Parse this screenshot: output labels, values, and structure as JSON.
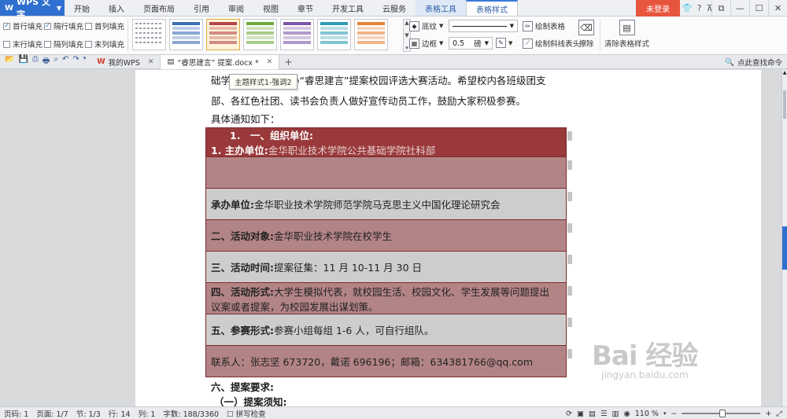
{
  "app": {
    "name": "WPS 文字",
    "logo": "W"
  },
  "menu": {
    "items": [
      "开始",
      "插入",
      "页面布局",
      "引用",
      "审阅",
      "视图",
      "章节",
      "开发工具",
      "云服务",
      "表格工具",
      "表格样式"
    ],
    "context_tab": "表格工具",
    "active_tab": "表格样式",
    "login": "未登录"
  },
  "top_icons": [
    "shirt-icon",
    "help-icon",
    "collapse-icon"
  ],
  "top_icon_glyphs": {
    "shirt": "👕",
    "help": "?",
    "collapse": "⊼"
  },
  "ribbon": {
    "checks": [
      {
        "label": "首行填充",
        "checked": true
      },
      {
        "label": "隔行填充",
        "checked": true
      },
      {
        "label": "首列填充",
        "checked": false
      },
      {
        "label": "末行填充",
        "checked": false
      },
      {
        "label": "隔列填充",
        "checked": false
      },
      {
        "label": "末列填充",
        "checked": false
      }
    ],
    "styles": [
      {
        "name": "plain",
        "color": "#9aa0a8"
      },
      {
        "name": "blue",
        "color": "#3c6db4"
      },
      {
        "name": "red",
        "color": "#b4444a"
      },
      {
        "name": "green",
        "color": "#6fa83b"
      },
      {
        "name": "purple",
        "color": "#7c56a8"
      },
      {
        "name": "teal",
        "color": "#2f9db4"
      },
      {
        "name": "orange",
        "color": "#e4823a"
      }
    ],
    "shading_label": "底纹",
    "border_label": "边框",
    "line_width": "0.5",
    "line_unit": "磅",
    "draw_table": "绘制表格",
    "draw_diag": "绘制斜线表头",
    "erase": "擦除",
    "clear_style": "清除表格样式"
  },
  "tabs": {
    "items": [
      {
        "label": "我的WPS",
        "icon": "W"
      },
      {
        "label": "“睿思建言” 提案.docx *",
        "icon": "doc"
      }
    ],
    "add": "+",
    "search_cmd": "点此查找命令"
  },
  "tooltip": "主题样式1-强调2",
  "document": {
    "lines": [
      "础学院社科部拟举办“睿思建言”提案校园评选大赛活动。希望校内各班级团支",
      "部、各红色社团、读书会负责人做好宣传动员工作，鼓励大家积极参赛。",
      "具体通知如下："
    ],
    "table": [
      {
        "style": "dark",
        "bold": "1.　一、组织单位:",
        "text": "",
        "sub_bold": "1. 主办单位:",
        "sub_text": "金华职业技术学院公共基础学院社科部"
      },
      {
        "style": "mid",
        "bold": "",
        "text": ""
      },
      {
        "style": "light",
        "bold": "承办单位:",
        "text": "金华职业技术学院师范学院马克思主义中国化理论研究会"
      },
      {
        "style": "mid",
        "bold": "二、活动对象:",
        "text": "金华职业技术学院在校学生"
      },
      {
        "style": "light",
        "bold": "三、活动时间:",
        "text": "提案征集：11 月 10-11 月 30 日"
      },
      {
        "style": "mid",
        "bold": "四、活动形式:",
        "text": "大学生模拟代表，就校园生活、校园文化、学生发展等问题提出",
        "text2": "议案或者提案，为校园发展出谋划策。"
      },
      {
        "style": "light",
        "bold": "五、参赛形式:",
        "text": "参赛小组每组 1-6 人，可自行组队。"
      },
      {
        "style": "mid",
        "bold": "",
        "text": "联系人：张志坚 673720，戴诺 696196；邮箱：634381766@qq.com"
      }
    ],
    "after": [
      "六、提案要求:",
      "（一）提案须知:"
    ]
  },
  "watermark": {
    "brand": "Bai 经验",
    "url": "jingyan.baidu.com"
  },
  "status": {
    "page_num": "页码: 1",
    "pages": "页面: 1/7",
    "section": "节: 1/3",
    "row": "行: 14",
    "col": "列: 1",
    "words": "字数: 188/3360",
    "spell": "拼写检查",
    "zoom": "110 %"
  },
  "colors": {
    "accent": "#2f6fcf",
    "login": "#e8553e",
    "table_dark": "#99393b",
    "table_mid": "#b38486",
    "table_light": "#cfcccd"
  }
}
